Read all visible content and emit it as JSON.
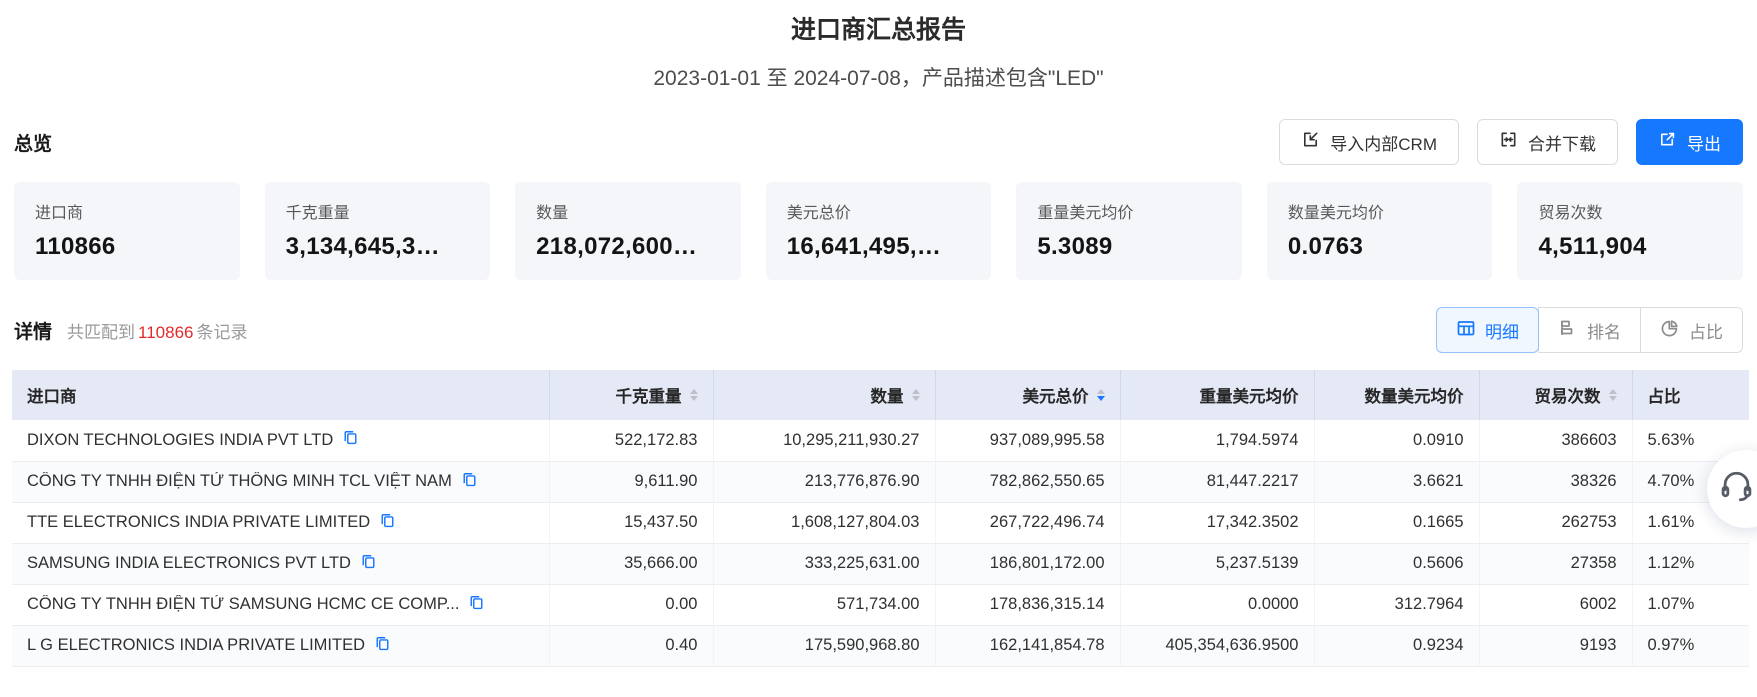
{
  "page": {
    "title": "进口商汇总报告",
    "subtitle": "2023-01-01 至 2024-07-08，产品描述包含\"LED\""
  },
  "overview": {
    "section_title": "总览",
    "actions": {
      "import_crm": "导入内部CRM",
      "merge_download": "合并下载",
      "export": "导出"
    },
    "cards": [
      {
        "label": "进口商",
        "value": "110866"
      },
      {
        "label": "千克重量",
        "value": "3,134,645,3…"
      },
      {
        "label": "数量",
        "value": "218,072,600…"
      },
      {
        "label": "美元总价",
        "value": "16,641,495,…"
      },
      {
        "label": "重量美元均价",
        "value": "5.3089"
      },
      {
        "label": "数量美元均价",
        "value": "0.0763"
      },
      {
        "label": "贸易次数",
        "value": "4,511,904"
      }
    ]
  },
  "details": {
    "section_title": "详情",
    "match_prefix": "共匹配到",
    "match_count": "110866",
    "match_suffix": "条记录",
    "view_tabs": [
      {
        "label": "明细",
        "icon": "table-icon",
        "active": true
      },
      {
        "label": "排名",
        "icon": "ranking-icon",
        "active": false
      },
      {
        "label": "占比",
        "icon": "pie-icon",
        "active": false
      }
    ]
  },
  "table": {
    "columns": [
      {
        "label": "进口商",
        "key": "importer",
        "align": "left",
        "sortable": false,
        "sorted": null
      },
      {
        "label": "千克重量",
        "key": "kg-weight",
        "align": "right",
        "sortable": true,
        "sorted": null
      },
      {
        "label": "数量",
        "key": "quantity",
        "align": "right",
        "sortable": true,
        "sorted": null
      },
      {
        "label": "美元总价",
        "key": "usd-total",
        "align": "right",
        "sortable": true,
        "sorted": "desc"
      },
      {
        "label": "重量美元均价",
        "key": "weight-usd-avg",
        "align": "right",
        "sortable": false,
        "sorted": null
      },
      {
        "label": "数量美元均价",
        "key": "qty-usd-avg",
        "align": "right",
        "sortable": false,
        "sorted": null
      },
      {
        "label": "贸易次数",
        "key": "trade-count",
        "align": "right",
        "sortable": true,
        "sorted": null
      },
      {
        "label": "占比",
        "key": "share",
        "align": "left",
        "sortable": false,
        "sorted": null
      }
    ],
    "rows": [
      [
        "DIXON TECHNOLOGIES INDIA PVT LTD",
        "522,172.83",
        "10,295,211,930.27",
        "937,089,995.58",
        "1,794.5974",
        "0.0910",
        "386603",
        "5.63%"
      ],
      [
        "CÔNG TY TNHH ĐIỆN TỬ THÔNG MINH TCL VIỆT NAM",
        "9,611.90",
        "213,776,876.90",
        "782,862,550.65",
        "81,447.2217",
        "3.6621",
        "38326",
        "4.70%"
      ],
      [
        "TTE ELECTRONICS INDIA PRIVATE LIMITED",
        "15,437.50",
        "1,608,127,804.03",
        "267,722,496.74",
        "17,342.3502",
        "0.1665",
        "262753",
        "1.61%"
      ],
      [
        "SAMSUNG INDIA ELECTRONICS PVT LTD",
        "35,666.00",
        "333,225,631.00",
        "186,801,172.00",
        "5,237.5139",
        "0.5606",
        "27358",
        "1.12%"
      ],
      [
        "CÔNG TY TNHH ĐIỆN TỬ SAMSUNG HCMC CE COMP...",
        "0.00",
        "571,734.00",
        "178,836,315.14",
        "0.0000",
        "312.7964",
        "6002",
        "1.07%"
      ],
      [
        "L G ELECTRONICS INDIA PRIVATE LIMITED",
        "0.40",
        "175,590,968.80",
        "162,141,854.78",
        "405,354,636.9500",
        "0.9234",
        "9193",
        "0.97%"
      ]
    ]
  },
  "floating": {
    "support_icon": "headset-icon"
  },
  "colors": {
    "accent": "#1677ff",
    "count_red": "#e02b2b",
    "table_header_bg": "#e4e9f5"
  }
}
